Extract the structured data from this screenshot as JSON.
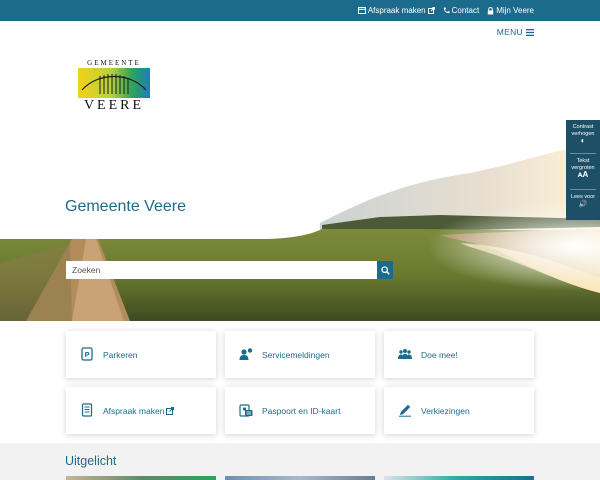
{
  "topbar": {
    "links": [
      {
        "label": "Afspraak maken",
        "icon": "calendar-icon"
      },
      {
        "label": "Contact",
        "icon": "phone-icon"
      },
      {
        "label": "Mijn Veere",
        "icon": "lock-icon"
      }
    ]
  },
  "header": {
    "menu_label": "MENU",
    "logo_top": "GEMEENTE",
    "logo_bottom": "VEERE"
  },
  "hero": {
    "title": "Gemeente Veere",
    "search_placeholder": "Zoeken"
  },
  "accessibility": {
    "items": [
      {
        "label": "Contrast verhogen",
        "glyph": "◐"
      },
      {
        "label": "Tekst vergroten",
        "glyph": "ᴀA"
      },
      {
        "label": "Lees voor",
        "glyph": "🔊"
      }
    ]
  },
  "tiles": [
    {
      "label": "Parkeren",
      "icon": "parking-icon"
    },
    {
      "label": "Servicemeldingen",
      "icon": "service-report-icon"
    },
    {
      "label": "Doe mee!",
      "icon": "people-group-icon"
    },
    {
      "label": "Afspraak maken",
      "icon": "form-list-icon",
      "external": true
    },
    {
      "label": "Paspoort en ID-kaart",
      "icon": "id-card-icon"
    },
    {
      "label": "Verkiezingen",
      "icon": "pencil-vote-icon"
    }
  ],
  "featured": {
    "title": "Uitgelicht"
  },
  "colors": {
    "primary": "#1d6b8c",
    "accessibility_panel": "#1d4f66"
  }
}
